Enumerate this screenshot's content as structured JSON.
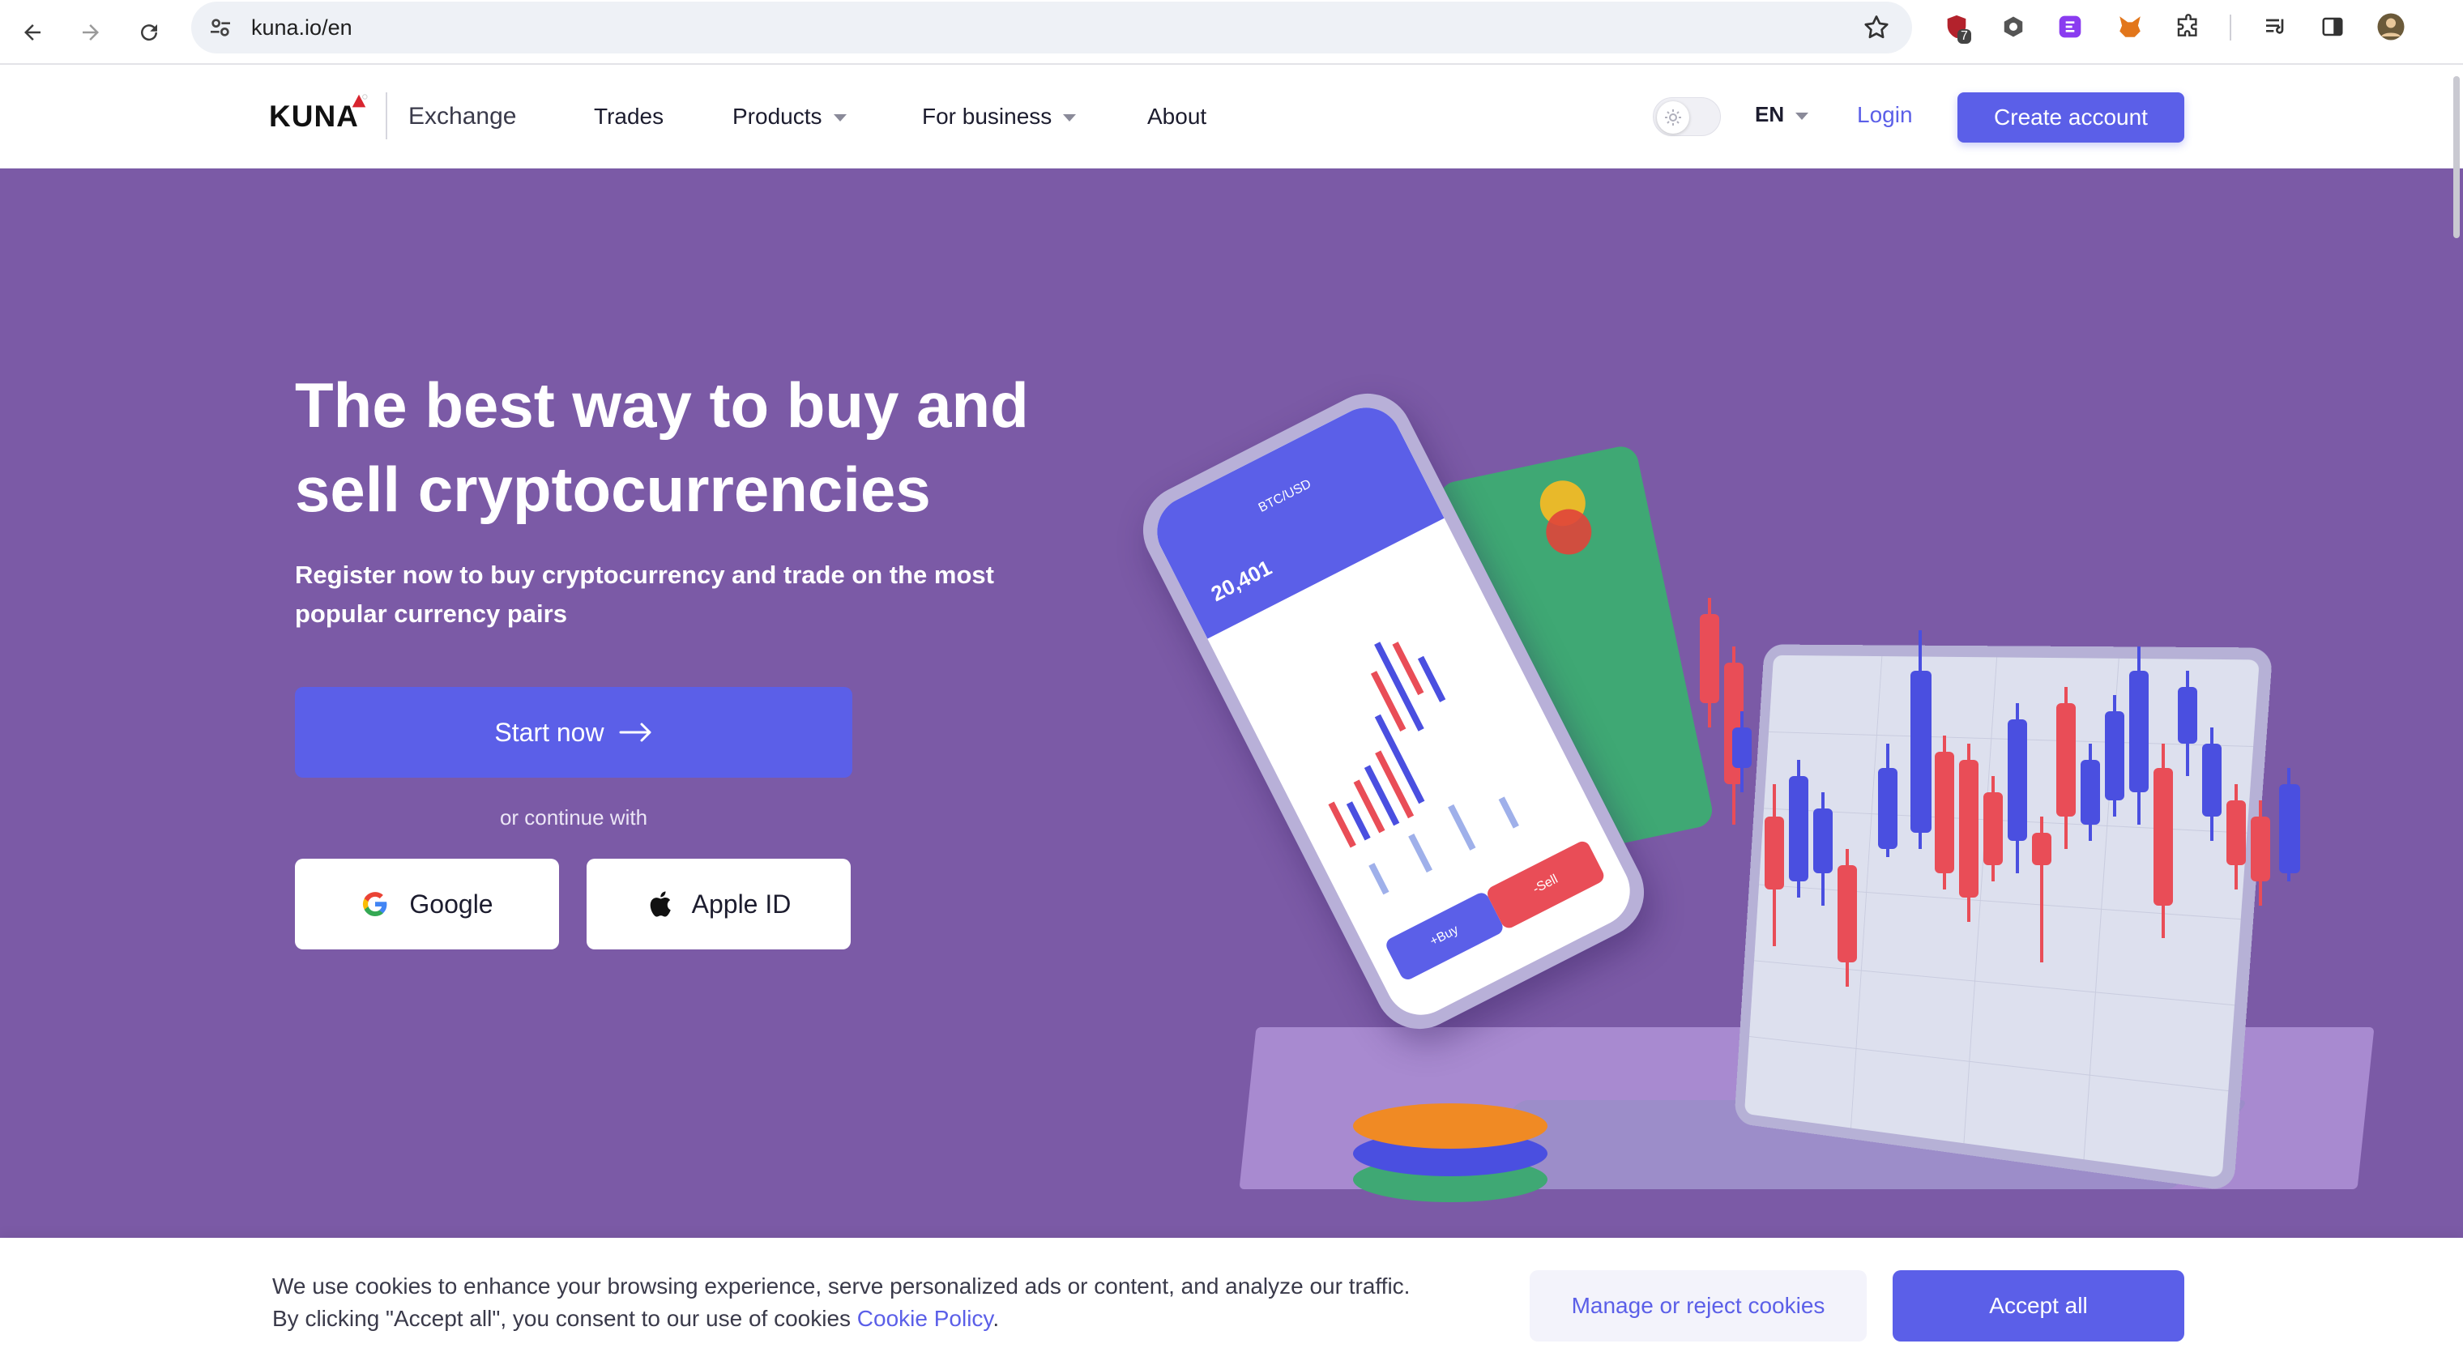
{
  "browser": {
    "url": "kuna.io/en",
    "extension_badge": "7"
  },
  "header": {
    "logo": "KUNA",
    "exchange": "Exchange",
    "nav": [
      {
        "label": "Trades"
      },
      {
        "label": "Products"
      },
      {
        "label": "For business"
      },
      {
        "label": "About"
      }
    ],
    "language": "EN",
    "login": "Login",
    "create_account": "Create account"
  },
  "hero": {
    "title": "The best way to buy and sell cryptocurrencies",
    "subtitle": "Register now to buy cryptocurrency and trade on the most popular currency pairs",
    "start_now": "Start now",
    "continue_with": "or continue with",
    "google": "Google",
    "apple": "Apple ID",
    "phone": {
      "pair": "BTC/USD",
      "price": "20,401",
      "buy": "+Buy",
      "sell": "-Sell"
    }
  },
  "cookie": {
    "text": "We use cookies to enhance your browsing experience, serve personalized ads or content, and analyze our traffic. By clicking \"Accept all\", you consent to our use of cookies ",
    "link": "Cookie Policy",
    "period": ".",
    "manage": "Manage or reject cookies",
    "accept": "Accept all"
  },
  "colors": {
    "accent": "#5b5fe8",
    "hero_bg": "#7b5aa6",
    "candle_red": "#e94d57",
    "candle_blue": "#4a4fe0"
  },
  "icons": [
    "back-icon",
    "forward-icon",
    "reload-icon",
    "site-settings-icon",
    "bookmark-star-icon",
    "google-icon",
    "apple-icon",
    "arrow-right-icon",
    "sun-icon"
  ]
}
